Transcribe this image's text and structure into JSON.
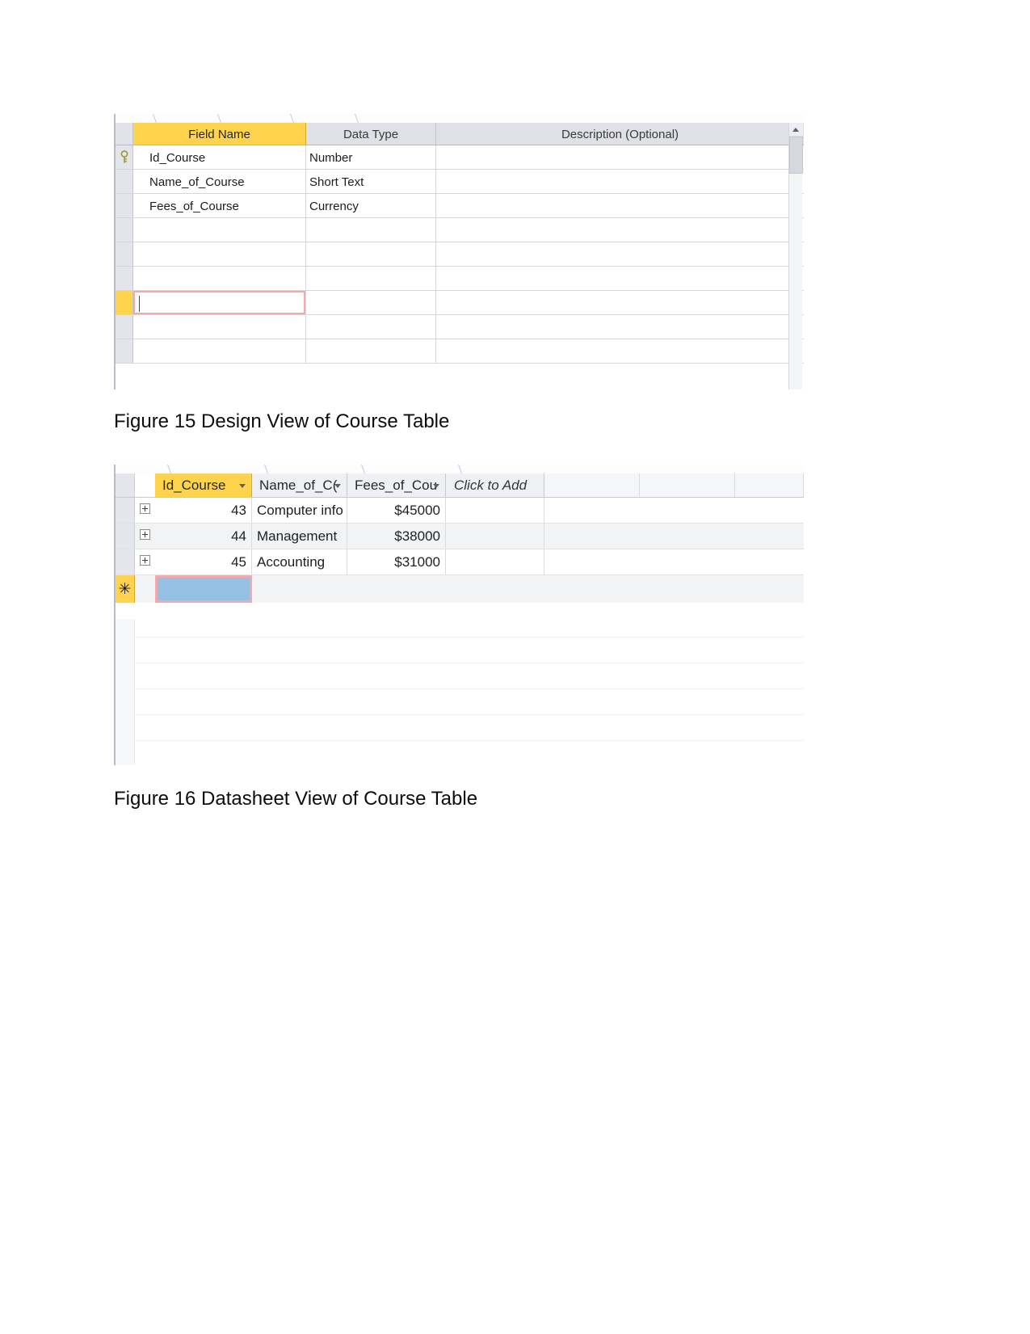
{
  "document": {
    "figures": [
      {
        "caption": "Figure 15 Design View of Course Table",
        "view": "design"
      },
      {
        "caption": "Figure 16 Datasheet View of Course Table",
        "view": "datasheet"
      }
    ]
  },
  "design_view": {
    "columns": [
      "Field Name",
      "Data Type",
      "Description (Optional)"
    ],
    "rows": [
      {
        "field_name": "Id_Course",
        "data_type": "Number",
        "description": "",
        "primary_key": true
      },
      {
        "field_name": "Name_of_Course",
        "data_type": "Short Text",
        "description": "",
        "primary_key": false
      },
      {
        "field_name": "Fees_of_Course",
        "data_type": "Currency",
        "description": "",
        "primary_key": false
      },
      {
        "field_name": "",
        "data_type": "",
        "description": "",
        "primary_key": false
      },
      {
        "field_name": "",
        "data_type": "",
        "description": "",
        "primary_key": false
      },
      {
        "field_name": "",
        "data_type": "",
        "description": "",
        "primary_key": false
      },
      {
        "field_name": "",
        "data_type": "",
        "description": "",
        "primary_key": false,
        "editing": true
      },
      {
        "field_name": "",
        "data_type": "",
        "description": "",
        "primary_key": false
      },
      {
        "field_name": "",
        "data_type": "",
        "description": "",
        "primary_key": false
      }
    ],
    "icons": {
      "primary_key": "key-icon",
      "scroll_up": "scroll-up-arrow-icon"
    }
  },
  "datasheet_view": {
    "columns": [
      {
        "label": "Id_Course",
        "selected": true
      },
      {
        "label": "Name_of_C(",
        "selected": false
      },
      {
        "label": "Fees_of_Cou",
        "selected": false
      }
    ],
    "add_field_label": "Click to Add",
    "rows": [
      {
        "id_course": "43",
        "name_of_course": "Computer info",
        "fees_of_course": "$45000"
      },
      {
        "id_course": "44",
        "name_of_course": "Management",
        "fees_of_course": "$38000"
      },
      {
        "id_course": "45",
        "name_of_course": "Accounting",
        "fees_of_course": "$31000"
      }
    ],
    "new_record": {
      "marker": "✳",
      "id_course": "",
      "name_of_course": "",
      "fees_of_course": ""
    },
    "icons": {
      "expand_row": "plus-expand-icon",
      "column_dropdown": "chevron-down-icon",
      "new_record": "asterisk-icon"
    }
  },
  "colors": {
    "header_yellow": "#ffd34e",
    "header_gray": "#dfe1e6",
    "selection_pink": "#f0a9ae",
    "selection_blue": "#94c1e3",
    "grid_line": "#d4d8de",
    "text": "#1c1c1c"
  }
}
